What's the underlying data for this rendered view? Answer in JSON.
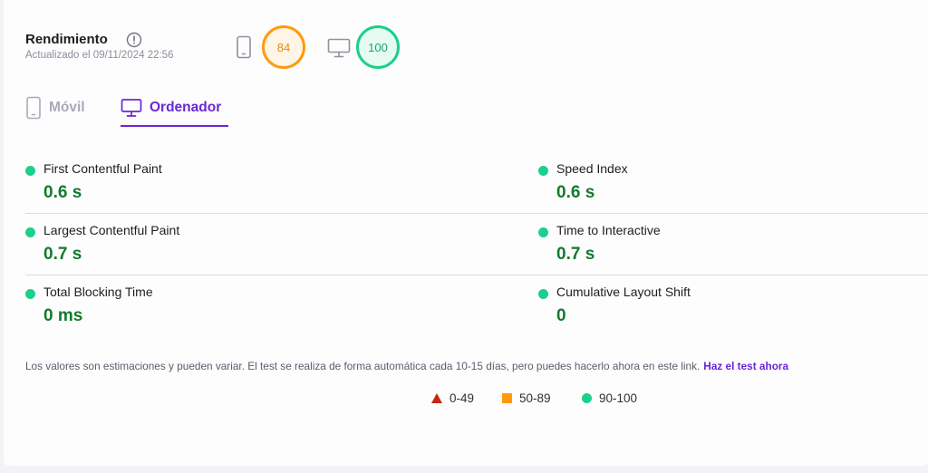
{
  "header": {
    "title": "Rendimiento",
    "updated": "Actualizado el 09/11/2024 22:56",
    "mobile_score": "84",
    "desktop_score": "100",
    "mobile_icon": "smartphone-icon",
    "desktop_icon": "monitor-icon",
    "info_icon": "info-icon"
  },
  "tabs": [
    {
      "label": "Móvil",
      "icon": "smartphone-icon",
      "active": false
    },
    {
      "label": "Ordenador",
      "icon": "monitor-icon",
      "active": true
    }
  ],
  "metrics": {
    "left": [
      {
        "name": "First Contentful Paint",
        "value": "0.6 s"
      },
      {
        "name": "Largest Contentful Paint",
        "value": "0.7 s"
      },
      {
        "name": "Total Blocking Time",
        "value": "0 ms"
      }
    ],
    "right": [
      {
        "name": "Speed Index",
        "value": "0.6 s"
      },
      {
        "name": "Time to Interactive",
        "value": "0.7 s"
      },
      {
        "name": "Cumulative Layout Shift",
        "value": "0"
      }
    ]
  },
  "note": {
    "text": "Los valores son estimaciones y pueden variar. El test se realiza de forma automática cada 10-15 días, pero puedes hacerlo ahora en este link.",
    "link": "Haz el test ahora"
  },
  "legend": [
    {
      "label": "0-49",
      "color": "#c4290e",
      "shape": "triangle"
    },
    {
      "label": "50-89",
      "color": "#ff9a0c",
      "shape": "square"
    },
    {
      "label": "90-100",
      "color": "#1ad08a",
      "shape": "circle"
    }
  ],
  "colors": {
    "accent": "#6a27d6",
    "good": "#1ad08a",
    "value_text": "#117a2e",
    "average": "#ff9a0c",
    "poor": "#c4290e"
  }
}
